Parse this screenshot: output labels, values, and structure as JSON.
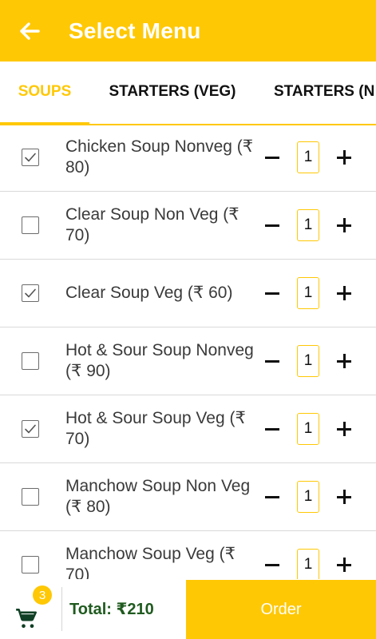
{
  "header": {
    "title": "Select Menu"
  },
  "tabs": [
    {
      "label": "SOUPS",
      "active": true
    },
    {
      "label": "STARTERS (VEG)",
      "active": false
    },
    {
      "label": "STARTERS (N",
      "active": false
    }
  ],
  "items": [
    {
      "name": "Chicken Soup Nonveg (₹ 80)",
      "checked": true,
      "qty": "1"
    },
    {
      "name": "Clear Soup Non Veg (₹ 70)",
      "checked": false,
      "qty": "1"
    },
    {
      "name": "Clear Soup Veg (₹ 60)",
      "checked": true,
      "qty": "1"
    },
    {
      "name": "Hot & Sour Soup Nonveg (₹ 90)",
      "checked": false,
      "qty": "1"
    },
    {
      "name": "Hot & Sour Soup Veg (₹ 70)",
      "checked": true,
      "qty": "1"
    },
    {
      "name": "Manchow Soup Non Veg (₹ 80)",
      "checked": false,
      "qty": "1"
    },
    {
      "name": "Manchow Soup Veg (₹ 70)",
      "checked": false,
      "qty": "1"
    }
  ],
  "footer": {
    "cart_count": "3",
    "total_label": "Total: ₹210",
    "order_label": "Order"
  },
  "colors": {
    "accent": "#FFC805",
    "total_text": "#1f5a1f"
  },
  "icons": {
    "back": "arrow-left-icon",
    "cart": "cart-icon"
  }
}
